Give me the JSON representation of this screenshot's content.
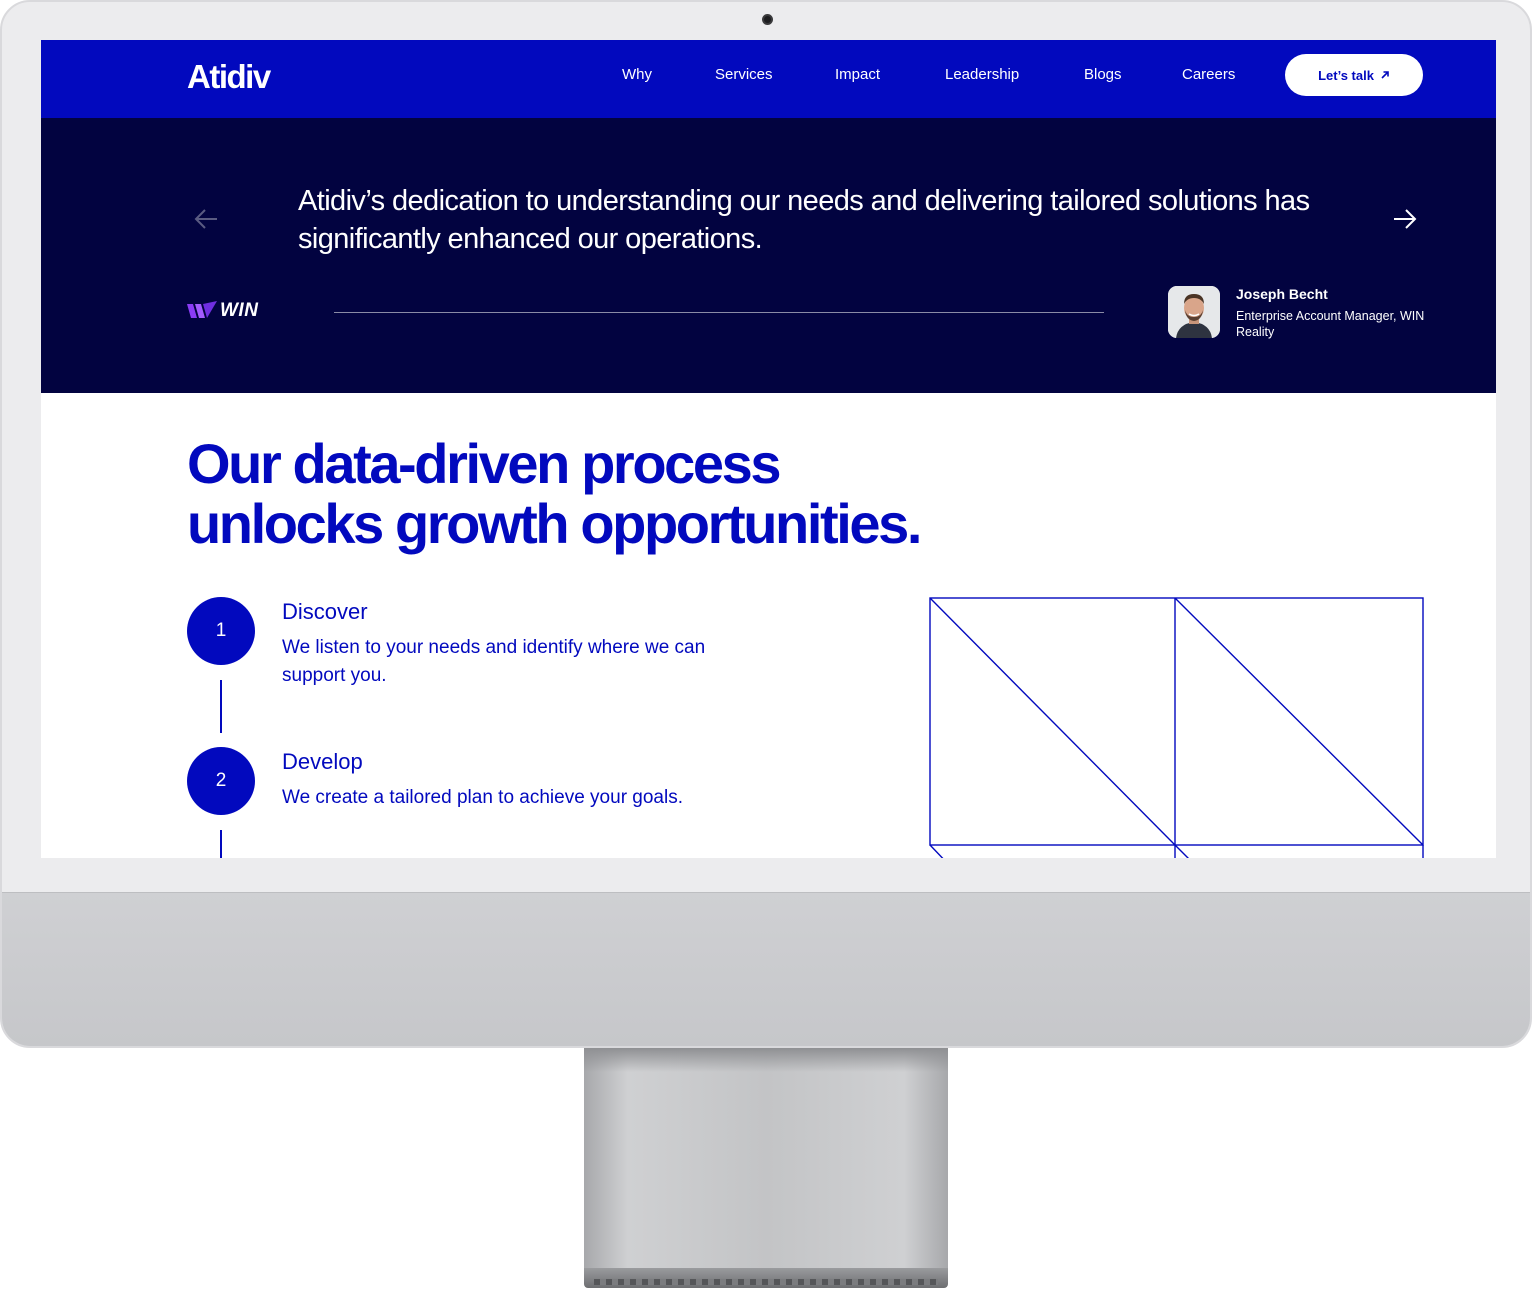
{
  "nav": {
    "logo": "Atidiv",
    "links": [
      "Why",
      "Services",
      "Impact",
      "Leadership",
      "Blogs",
      "Careers"
    ],
    "cta_label": "Let’s talk"
  },
  "testimonial": {
    "quote": "Atidiv’s dedication to understanding our needs and delivering tailored solutions has significantly enhanced our operations.",
    "company_logo": "WIN",
    "author_name": "Joseph Becht",
    "author_role": "Enterprise Account Manager, WIN Reality"
  },
  "process": {
    "headline_line1": "Our data-driven process",
    "headline_line2": "unlocks growth opportunities.",
    "steps": [
      {
        "number": "1",
        "title": "Discover",
        "description": "We listen to your needs and identify where we can support you."
      },
      {
        "number": "2",
        "title": "Develop",
        "description": "We create a tailored plan to achieve your goals."
      }
    ]
  },
  "colors": {
    "brand_blue": "#0209be",
    "navy": "#020340",
    "win_purple": "#8b3cf6"
  },
  "icons": {
    "prev": "arrow-left-icon",
    "next": "arrow-right-icon",
    "cta": "arrow-up-right-icon"
  }
}
